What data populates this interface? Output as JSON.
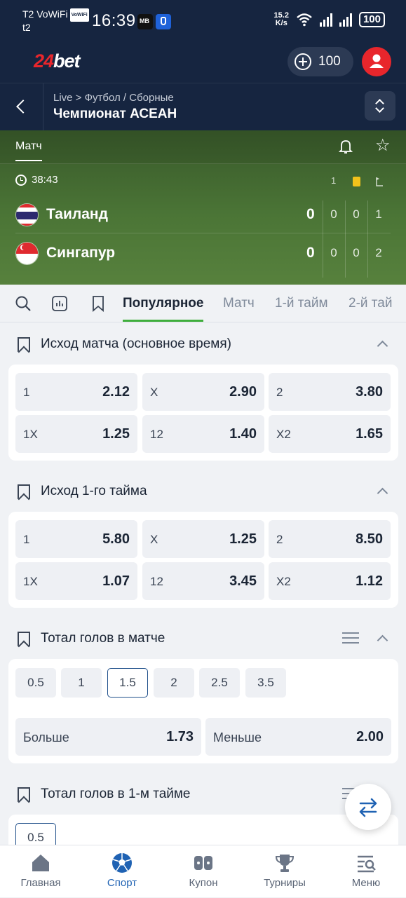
{
  "status_bar": {
    "carrier": "T2 VoWiFi",
    "carrier_badge": "VoWiFi",
    "carrier_line2": "t2",
    "time": "16:39",
    "speed_value": "15.2",
    "speed_unit": "K/s",
    "battery": "100"
  },
  "header": {
    "logo_number": "24",
    "logo_text": "bet",
    "balance": "100",
    "accent_color": "#e8262c"
  },
  "breadcrumb": {
    "path": "Live > Футбол / Сборные",
    "title": "Чемпионат АСЕАН"
  },
  "match": {
    "tab_label": "Матч",
    "timer": "38:43",
    "col_heads": [
      "1",
      "card-yellow",
      "corner"
    ],
    "teams": [
      {
        "name": "Таиланд",
        "score": "0",
        "stats": [
          "0",
          "0",
          "1"
        ]
      },
      {
        "name": "Сингапур",
        "score": "0",
        "stats": [
          "0",
          "0",
          "2"
        ]
      }
    ]
  },
  "market_tabs": [
    "Популярное",
    "Матч",
    "1-й тайм",
    "2-й тай"
  ],
  "sections": [
    {
      "title": "Исход матча (основное время)",
      "odds": [
        {
          "label": "1",
          "value": "2.12"
        },
        {
          "label": "X",
          "value": "2.90"
        },
        {
          "label": "2",
          "value": "3.80"
        },
        {
          "label": "1X",
          "value": "1.25"
        },
        {
          "label": "12",
          "value": "1.40"
        },
        {
          "label": "X2",
          "value": "1.65"
        }
      ]
    },
    {
      "title": "Исход 1-го тайма",
      "odds": [
        {
          "label": "1",
          "value": "5.80"
        },
        {
          "label": "X",
          "value": "1.25"
        },
        {
          "label": "2",
          "value": "8.50"
        },
        {
          "label": "1X",
          "value": "1.07"
        },
        {
          "label": "12",
          "value": "3.45"
        },
        {
          "label": "X2",
          "value": "1.12"
        }
      ]
    },
    {
      "title": "Тотал голов в матче",
      "lines": [
        "0.5",
        "1",
        "1.5",
        "2",
        "2.5",
        "3.5"
      ],
      "selected_line": "1.5",
      "over": {
        "label": "Больше",
        "value": "1.73"
      },
      "under": {
        "label": "Меньше",
        "value": "2.00"
      }
    },
    {
      "title": "Тотал голов в 1-м тайме",
      "lines": [
        "0.5"
      ]
    }
  ],
  "bottom_nav": [
    {
      "label": "Главная",
      "icon": "home-icon"
    },
    {
      "label": "Спорт",
      "icon": "soccer-ball-icon"
    },
    {
      "label": "Купон",
      "icon": "coupon-icon"
    },
    {
      "label": "Турниры",
      "icon": "trophy-icon"
    },
    {
      "label": "Меню",
      "icon": "menu-search-icon"
    }
  ]
}
